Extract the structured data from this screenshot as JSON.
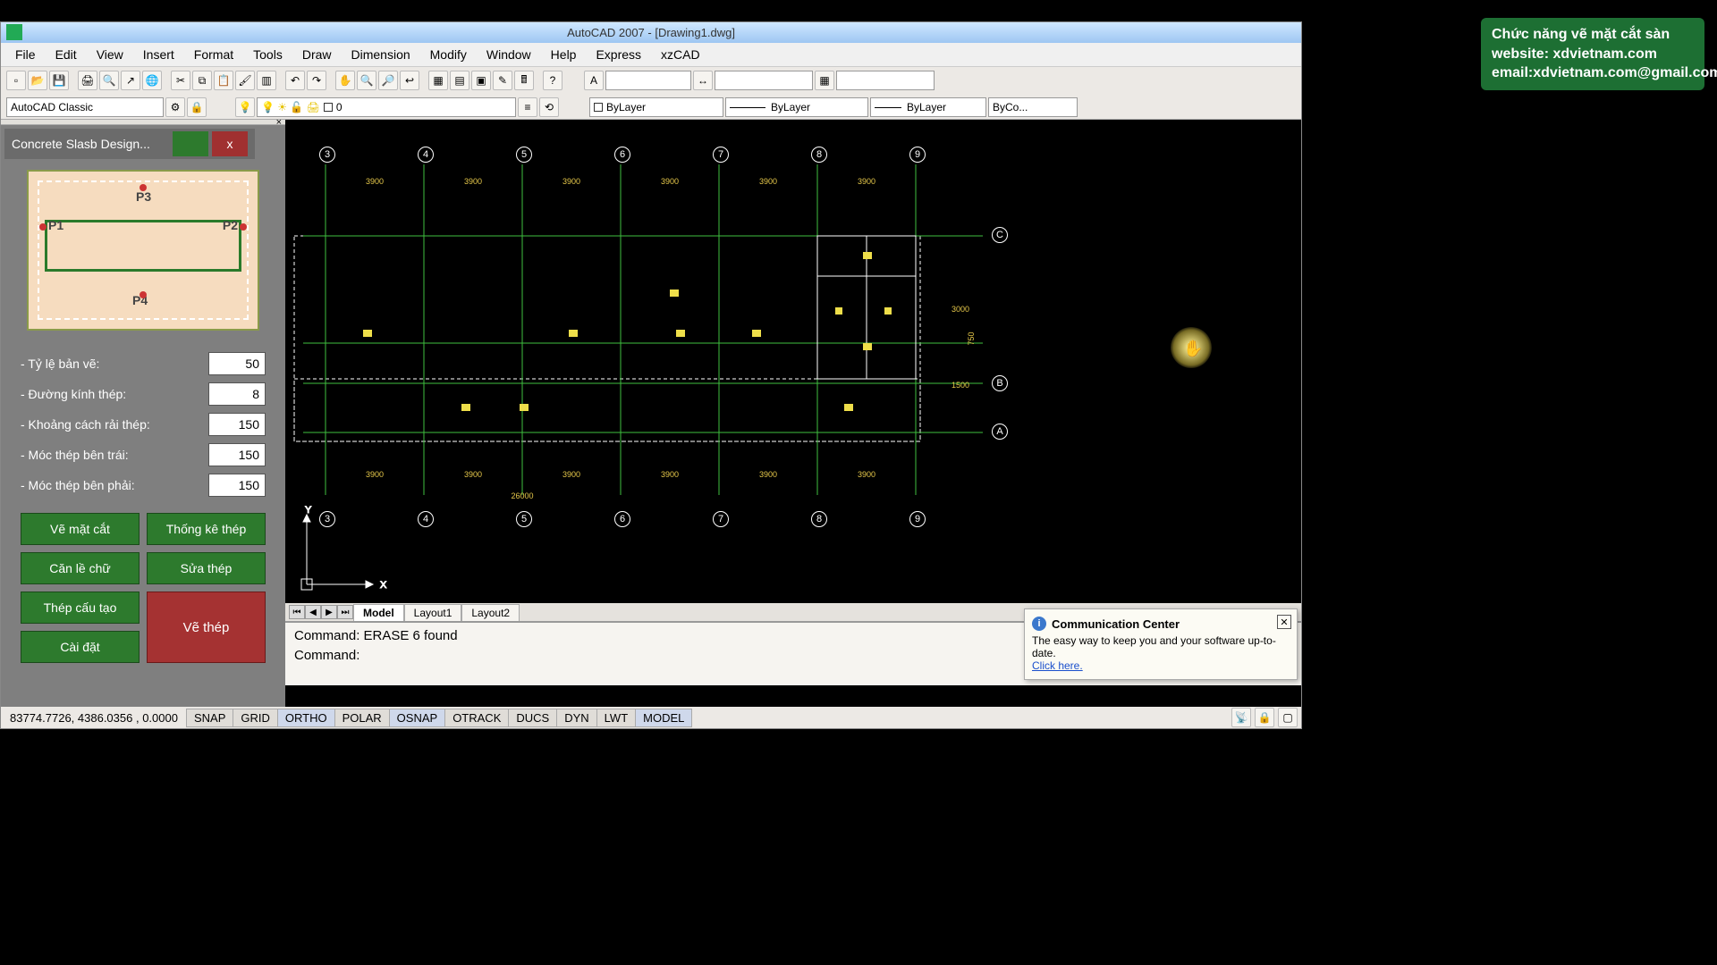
{
  "window": {
    "title": "AutoCAD 2007 - [Drawing1.dwg]"
  },
  "menus": [
    "File",
    "Edit",
    "View",
    "Insert",
    "Format",
    "Tools",
    "Draw",
    "Dimension",
    "Modify",
    "Window",
    "Help",
    "Express",
    "xzCAD"
  ],
  "workspace": {
    "name": "AutoCAD Classic"
  },
  "layer": {
    "current": "0"
  },
  "props": {
    "color": "ByLayer",
    "ltype": "ByLayer",
    "lweight": "ByLayer",
    "style": "ByCo..."
  },
  "panel": {
    "title": "Concrete Slasb Design...",
    "points": {
      "p1": "P1",
      "p2": "P2",
      "p3": "P3",
      "p4": "P4"
    },
    "fields": {
      "f1_label": "- Tỷ lệ bản vẽ:",
      "f1_val": "50",
      "f2_label": "- Đường kính thép:",
      "f2_val": "8",
      "f3_label": "- Khoảng cách rải thép:",
      "f3_val": "150",
      "f4_label": "- Móc thép bên trái:",
      "f4_val": "150",
      "f5_label": "- Móc thép bên phải:",
      "f5_val": "150"
    },
    "buttons": {
      "b1": "Vẽ mặt cắt",
      "b2": "Thống kê thép",
      "b3": "Căn lề chữ",
      "b4": "Sửa thép",
      "b5": "Thép cấu tạo",
      "b6": "Vẽ thép",
      "b7": "Cài đặt"
    }
  },
  "grid": {
    "cols": [
      "3",
      "4",
      "5",
      "6",
      "7",
      "8",
      "9"
    ],
    "rows_right": [
      "C",
      "B",
      "A"
    ],
    "top_dims": [
      "3900",
      "3900",
      "3900",
      "3900",
      "3900",
      "3900"
    ],
    "bot_dims": [
      "3900",
      "3900",
      "3900",
      "3900",
      "3900",
      "3900"
    ],
    "right_dims": [
      "3000",
      "1500",
      "750"
    ],
    "total_bottom": "26000"
  },
  "tabs": {
    "t1": "Model",
    "t2": "Layout1",
    "t3": "Layout2"
  },
  "cmd": {
    "l1": "Command:  ERASE 6 found",
    "l2": "Command:"
  },
  "status": {
    "coords": "83774.7726, 4386.0356 , 0.0000",
    "toggles": [
      "SNAP",
      "GRID",
      "ORTHO",
      "POLAR",
      "OSNAP",
      "OTRACK",
      "DUCS",
      "DYN",
      "LWT",
      "MODEL"
    ]
  },
  "popup": {
    "title": "Communication Center",
    "body": "The easy way to keep you and your software up-to-date.",
    "link": "Click here."
  },
  "watermark": {
    "l1": "Chức năng vẽ mặt cắt sàn",
    "l2": "website: xdvietnam.com",
    "l3": "email:xdvietnam.com@gmail.com"
  },
  "ucs": {
    "x": "X",
    "y": "Y"
  }
}
